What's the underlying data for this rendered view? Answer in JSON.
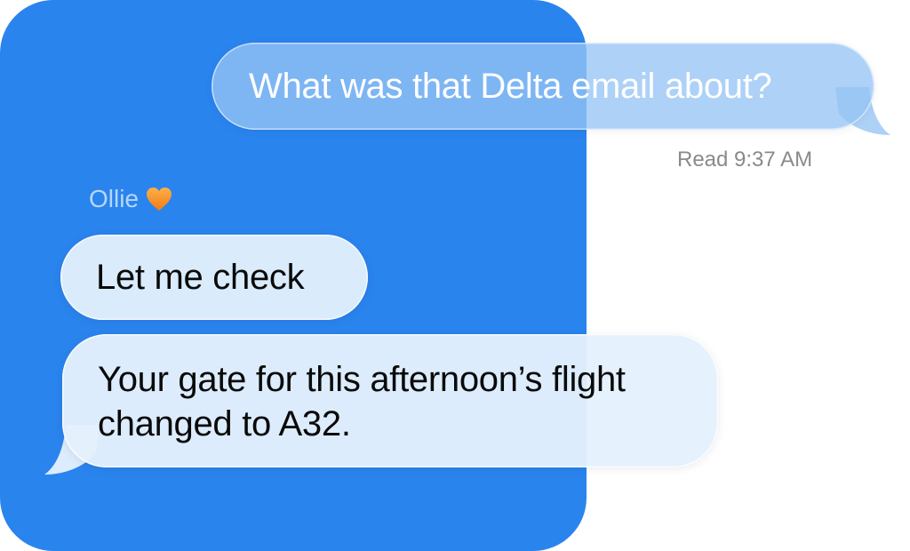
{
  "conversation": {
    "sent": {
      "text": "What was that Delta email about?",
      "receipt": "Read 9:37 AM"
    },
    "sender": {
      "name": "Ollie",
      "emoji_icon": "orange-heart-icon"
    },
    "received": [
      {
        "text": "Let me check"
      },
      {
        "text": "Your gate for this afternoon’s flight changed to A32."
      }
    ]
  },
  "colors": {
    "panel_blue": "#2a84ee",
    "sent_bubble": "#96c4f5",
    "received_bubble": "#e0eefc",
    "sender_name": "#b6d6fb",
    "receipt_gray": "#8a8a8e",
    "heart_orange": "#f5901e"
  }
}
